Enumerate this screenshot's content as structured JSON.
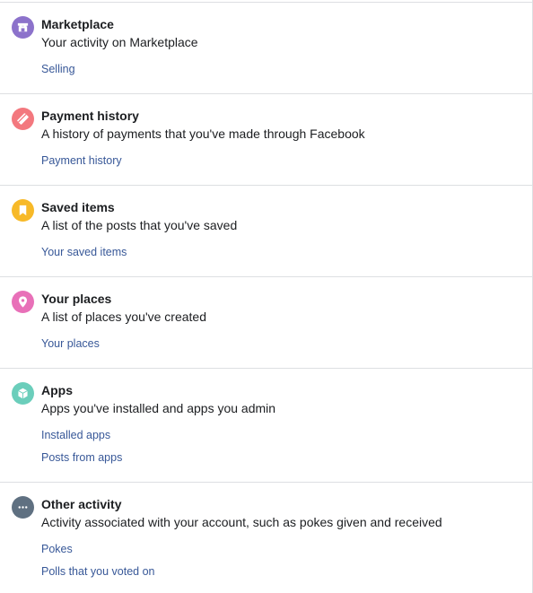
{
  "sections": [
    {
      "title": "Marketplace",
      "description": "Your activity on Marketplace",
      "icon": "marketplace-icon",
      "icon_color": "#8c72cb",
      "links": [
        "Selling"
      ]
    },
    {
      "title": "Payment history",
      "description": "A history of payments that you've made through Facebook",
      "icon": "payment-icon",
      "icon_color": "#f3787e",
      "links": [
        "Payment history"
      ]
    },
    {
      "title": "Saved items",
      "description": "A list of the posts that you've saved",
      "icon": "bookmark-icon",
      "icon_color": "#f7b928",
      "links": [
        "Your saved items"
      ]
    },
    {
      "title": "Your places",
      "description": "A list of places you've created",
      "icon": "location-pin-icon",
      "icon_color": "#e870b8",
      "links": [
        "Your places"
      ]
    },
    {
      "title": "Apps",
      "description": "Apps you've installed and apps you admin",
      "icon": "apps-cube-icon",
      "icon_color": "#6bcebb",
      "links": [
        "Installed apps",
        "Posts from apps"
      ]
    },
    {
      "title": "Other activity",
      "description": "Activity associated with your account, such as pokes given and received",
      "icon": "more-dots-icon",
      "icon_color": "#5f7081",
      "links": [
        "Pokes",
        "Polls that you voted on"
      ]
    }
  ],
  "colors": {
    "link": "#385898",
    "divider": "#dddfe2",
    "text": "#1c1e21"
  }
}
